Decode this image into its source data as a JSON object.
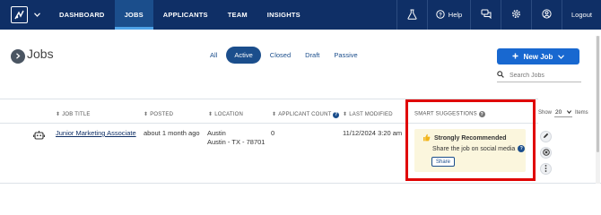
{
  "nav": {
    "items": [
      {
        "label": "DASHBOARD",
        "active": false
      },
      {
        "label": "JOBS",
        "active": true
      },
      {
        "label": "APPLICANTS",
        "active": false
      },
      {
        "label": "TEAM",
        "active": false
      },
      {
        "label": "INSIGHTS",
        "active": false
      }
    ],
    "help_label": "Help",
    "logout_label": "Logout"
  },
  "page": {
    "title": "Jobs"
  },
  "filters": [
    {
      "label": "All",
      "active": false
    },
    {
      "label": "Active",
      "active": true
    },
    {
      "label": "Closed",
      "active": false
    },
    {
      "label": "Draft",
      "active": false
    },
    {
      "label": "Passive",
      "active": false
    }
  ],
  "new_job_label": "New Job",
  "search": {
    "placeholder": "Search Jobs"
  },
  "table": {
    "headers": {
      "job_title": "JOB TITLE",
      "posted": "POSTED",
      "location": "LOCATION",
      "applicant_count": "APPLICANT COUNT",
      "last_modified": "LAST MODIFIED",
      "smart_suggestions": "SMART SUGGESTIONS"
    },
    "rows": [
      {
        "job_title": "Junior Marketing Associate",
        "posted": "about 1 month ago",
        "location_line1": "Austin",
        "location_line2": "Austin - TX - 78701",
        "applicant_count": "0",
        "last_modified": "11/12/2024 3:20 am",
        "suggestion": {
          "title": "Strongly Recommended",
          "text": "Share the job on social media",
          "action_label": "Share"
        }
      }
    ]
  },
  "pagination": {
    "show_label": "Show",
    "show_value": "20",
    "items_label": "Items"
  },
  "colors": {
    "nav_bg": "#0f2f66",
    "primary": "#1868d0",
    "highlight_border": "#e00000",
    "suggestion_bg": "#fbf6dd"
  }
}
